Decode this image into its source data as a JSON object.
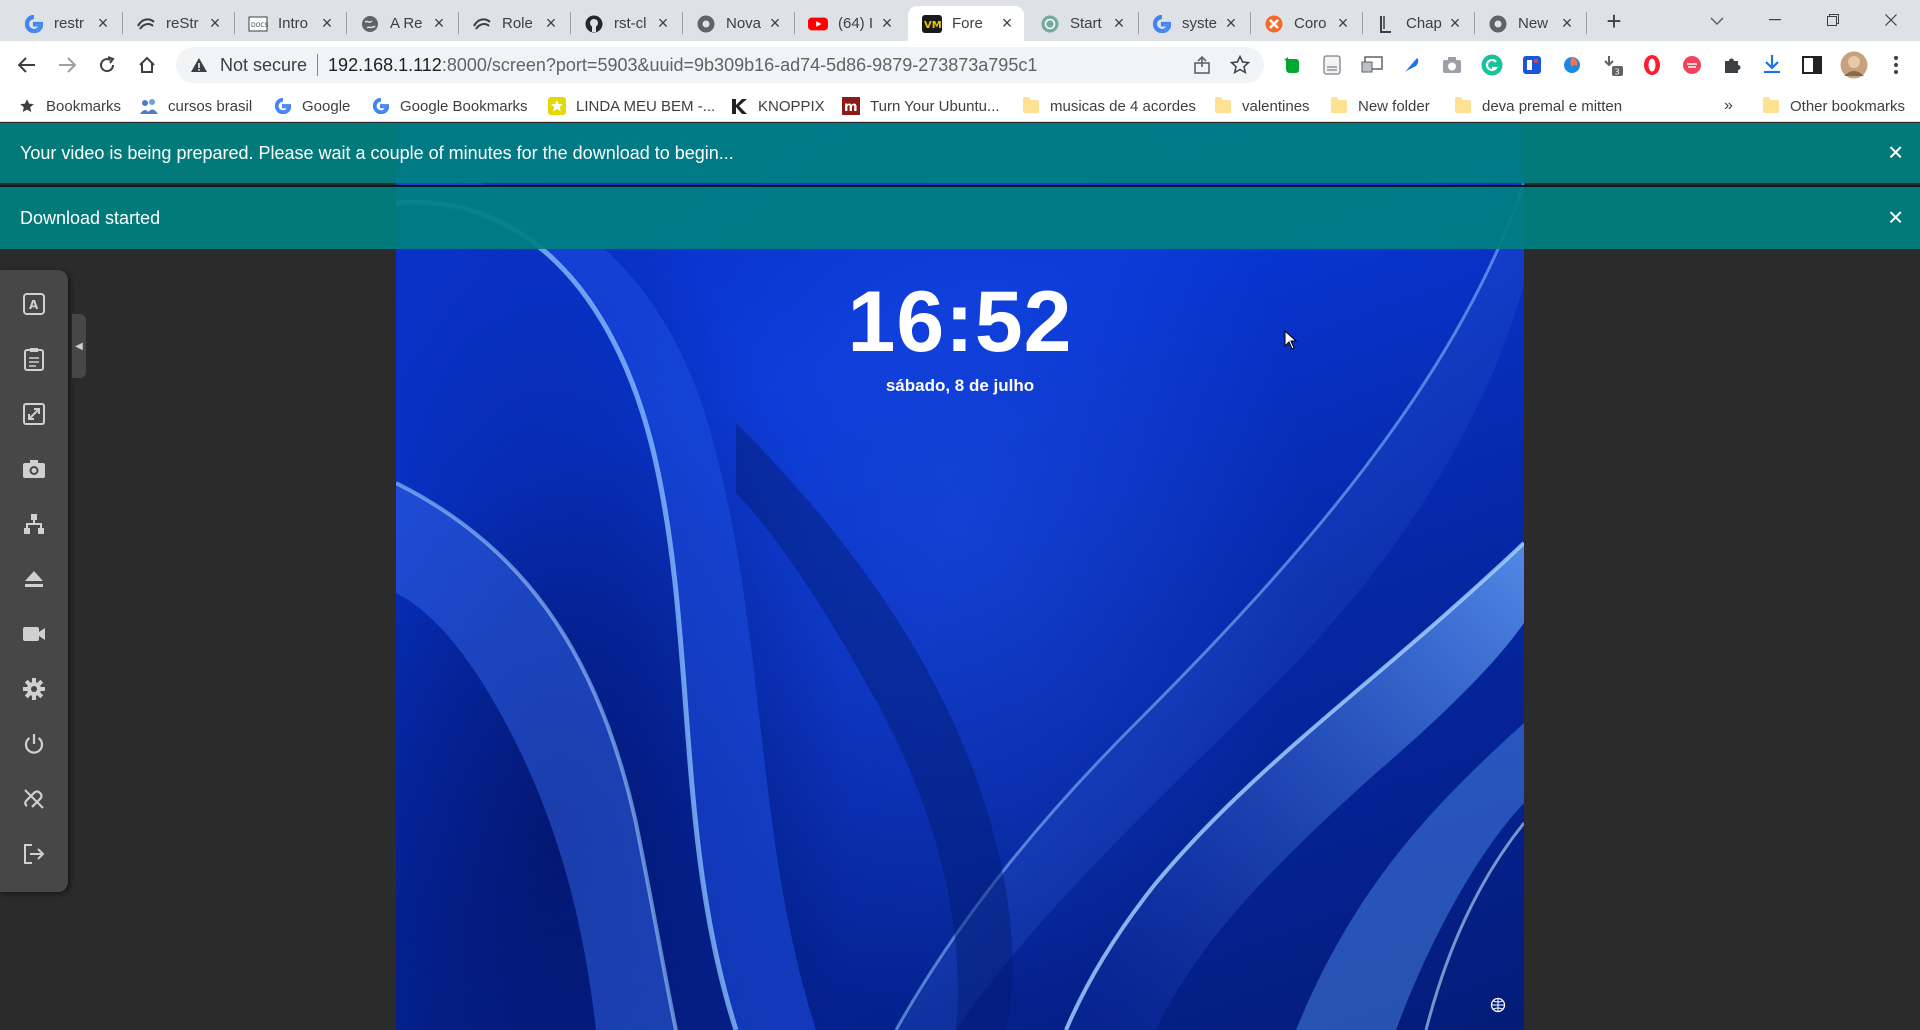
{
  "tabs": [
    {
      "title": "restr",
      "icon": "google-icon"
    },
    {
      "title": "reStr",
      "icon": "restream-icon"
    },
    {
      "title": "Intro",
      "icon": "docs-icon"
    },
    {
      "title": "A Re",
      "icon": "globe-icon"
    },
    {
      "title": "Role",
      "icon": "restream-icon"
    },
    {
      "title": "rst-cl",
      "icon": "github-icon"
    },
    {
      "title": "Nova",
      "icon": "chrome-icon"
    },
    {
      "title": "(64) I",
      "icon": "youtube-icon"
    },
    {
      "title": "Fore",
      "icon": "vm-icon"
    },
    {
      "title": "Start",
      "icon": "openai-icon"
    },
    {
      "title": "syste",
      "icon": "google-icon"
    },
    {
      "title": "Coro",
      "icon": "xmind-icon"
    },
    {
      "title": "Chap",
      "icon": "bracket-icon"
    },
    {
      "title": "New",
      "icon": "chrome-icon"
    }
  ],
  "toolbar": {
    "security_label": "Not secure",
    "url_host": "192.168.1.112",
    "url_rest": ":8000/screen?port=5903&uuid=9b309b16-ad74-5d86-9879-273873a795c1",
    "downloads_badge": "3"
  },
  "bookmarks": [
    {
      "label": "Bookmarks",
      "icon": "star-icon"
    },
    {
      "label": "cursos brasil",
      "icon": "people-icon"
    },
    {
      "label": "Google",
      "icon": "google-icon"
    },
    {
      "label": "Google Bookmarks",
      "icon": "google-icon"
    },
    {
      "label": "LINDA MEU BEM -...",
      "icon": "star-badge-icon"
    },
    {
      "label": "KNOPPIX",
      "icon": "knoppix-icon"
    },
    {
      "label": "Turn Your Ubuntu...",
      "icon": "m-icon"
    },
    {
      "label": "musicas de 4 acordes",
      "icon": "folder-icon"
    },
    {
      "label": "valentines",
      "icon": "folder-icon"
    },
    {
      "label": "New folder",
      "icon": "folder-icon"
    },
    {
      "label": "deva premal e mitten",
      "icon": "folder-icon"
    }
  ],
  "bookmarks_overflow": "»",
  "other_bookmarks": "Other bookmarks",
  "notifications": [
    {
      "text": "Your video is being prepared. Please wait a couple of minutes for the download to begin..."
    },
    {
      "text": "Download started"
    }
  ],
  "lockscreen": {
    "time": "16:52",
    "date": "sábado, 8 de julho"
  },
  "sidemenu": [
    {
      "name": "keyboard-icon"
    },
    {
      "name": "clipboard-icon"
    },
    {
      "name": "fullscreen-icon"
    },
    {
      "name": "camera-icon"
    },
    {
      "name": "network-icon"
    },
    {
      "name": "eject-icon"
    },
    {
      "name": "video-icon"
    },
    {
      "name": "settings-icon"
    },
    {
      "name": "power-icon"
    },
    {
      "name": "disconnect-icon"
    },
    {
      "name": "exit-icon"
    }
  ],
  "colors": {
    "notification_bg": "#008080",
    "sidemenu_bg": "#474747",
    "tabstrip_bg": "#dee1e6",
    "wallpaper_blue": "#0937d6"
  }
}
